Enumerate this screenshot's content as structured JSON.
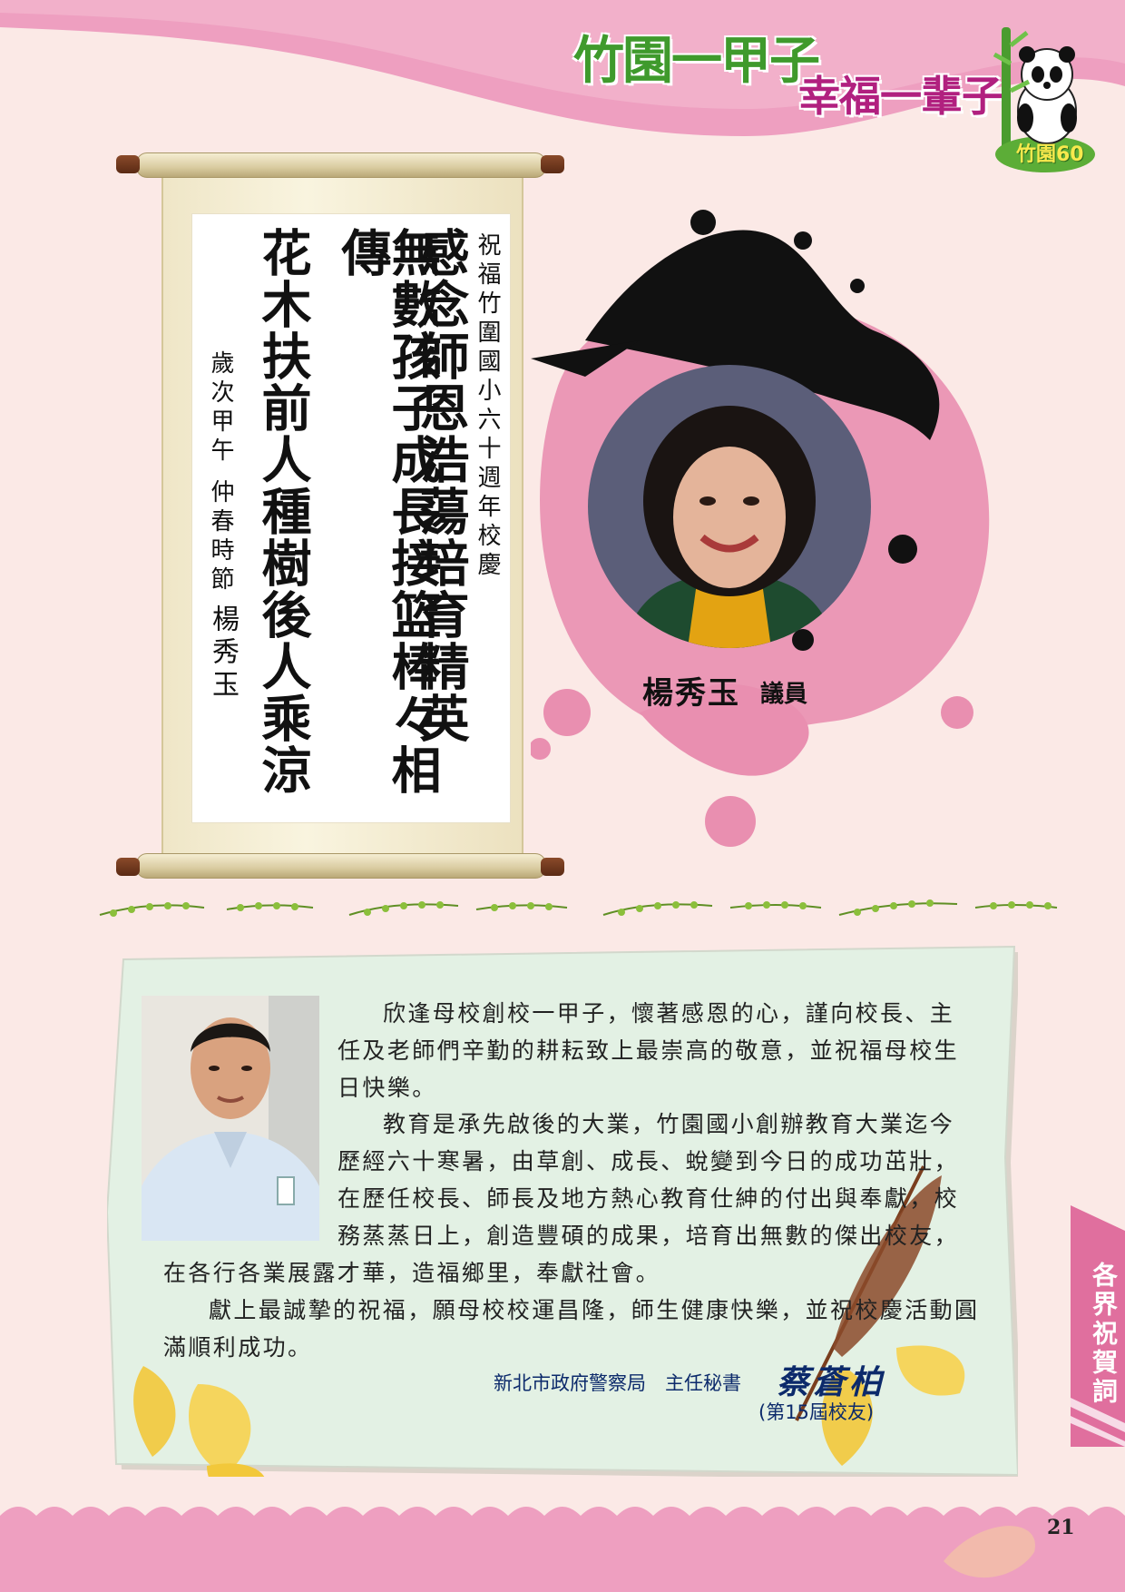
{
  "header": {
    "title_line1": "竹園一甲子",
    "title_line2": "幸福一輩子",
    "mascot_label": "竹園60"
  },
  "calligraphy": {
    "dedication": "祝福竹圍國小六十週年校慶",
    "line1": "感念師恩浩蕩培育精英",
    "line2": "無數孩子成長接篮棒々相傳",
    "line3": "花木扶前人種樹後人乘涼",
    "date_line": "歲次甲午 仲春時節",
    "signature": "楊秀玉"
  },
  "councillor": {
    "name": "楊秀玉",
    "title": "議員"
  },
  "message": {
    "paragraph1_lines": [
      "欣逢母校創校一甲子，懷著感恩的心，謹向校長、主",
      "任及老師們辛勤的耕耘致上最崇高的敬意，並祝福母校生",
      "日快樂。"
    ],
    "paragraph2_lines": [
      "教育是承先啟後的大業，竹園國小創辦教育大業迄今",
      "歷經六十寒暑，由草創、成長、蛻變到今日的成功茁壯，",
      "在歷任校長、師長及地方熱心教育仕紳的付出與奉獻，校",
      "務蒸蒸日上，創造豐碩的成果，培育出無數的傑出校友，"
    ],
    "paragraph2_tail": "在各行各業展露才華，造福鄉里，奉獻社會。",
    "paragraph3_lines": [
      "獻上最誠摯的祝福，願母校校運昌隆，師生健康快樂，並祝校慶活動圓",
      "滿順利成功。"
    ],
    "signer_org": "新北市政府警察局　主任秘書",
    "signer_name": "蔡蒼柏",
    "signer_alumni": "(第15屆校友)"
  },
  "side_tab": {
    "label": "各界祝賀詞"
  },
  "footer": {
    "page_number": "21"
  },
  "colors": {
    "pink": "#e98fb0",
    "dark_pink": "#c4507e",
    "green": "#3f9a2c",
    "magenta": "#b1207f",
    "navy": "#0c2a6b",
    "card_bg": "#e3f1e4"
  }
}
